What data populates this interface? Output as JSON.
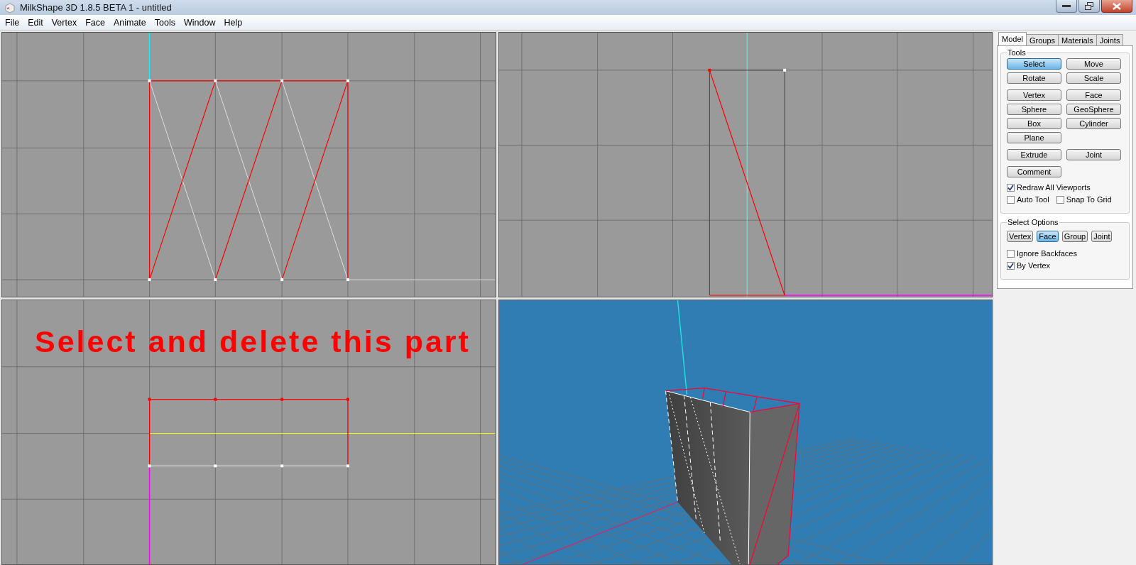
{
  "window": {
    "title": "MilkShape 3D 1.8.5 BETA 1 - untitled"
  },
  "menu": [
    "File",
    "Edit",
    "Vertex",
    "Face",
    "Animate",
    "Tools",
    "Window",
    "Help"
  ],
  "annotation": {
    "text": "Select and delete this part"
  },
  "panel": {
    "tabs": [
      {
        "label": "Model",
        "selected": true
      },
      {
        "label": "Groups",
        "selected": false
      },
      {
        "label": "Materials",
        "selected": false
      },
      {
        "label": "Joints",
        "selected": false
      }
    ],
    "tools": {
      "title": "Tools",
      "button_groups": [
        [
          {
            "label": "Select",
            "selected": true
          },
          {
            "label": "Move",
            "selected": false
          },
          {
            "label": "Rotate",
            "selected": false
          },
          {
            "label": "Scale",
            "selected": false
          }
        ],
        [
          {
            "label": "Vertex",
            "selected": false
          },
          {
            "label": "Face",
            "selected": false
          },
          {
            "label": "Sphere",
            "selected": false
          },
          {
            "label": "GeoSphere",
            "selected": false
          },
          {
            "label": "Box",
            "selected": false
          },
          {
            "label": "Cylinder",
            "selected": false
          },
          {
            "label": "Plane",
            "selected": false
          }
        ],
        [
          {
            "label": "Extrude",
            "selected": false
          },
          {
            "label": "Joint",
            "selected": false
          }
        ],
        [
          {
            "label": "Comment",
            "selected": false
          }
        ]
      ],
      "option_rows": [
        [
          {
            "label": "Redraw All Viewports",
            "checked": true
          }
        ],
        [
          {
            "label": "Auto Tool",
            "checked": false
          },
          {
            "label": "Snap To Grid",
            "checked": false
          }
        ]
      ]
    },
    "select_options": {
      "title": "Select Options",
      "modes": [
        {
          "label": "Vertex",
          "selected": false
        },
        {
          "label": "Face",
          "selected": true
        },
        {
          "label": "Group",
          "selected": false
        },
        {
          "label": "Joint",
          "selected": false
        }
      ],
      "options": [
        {
          "label": "Ignore Backfaces",
          "checked": false
        },
        {
          "label": "By Vertex",
          "checked": true
        }
      ]
    }
  }
}
